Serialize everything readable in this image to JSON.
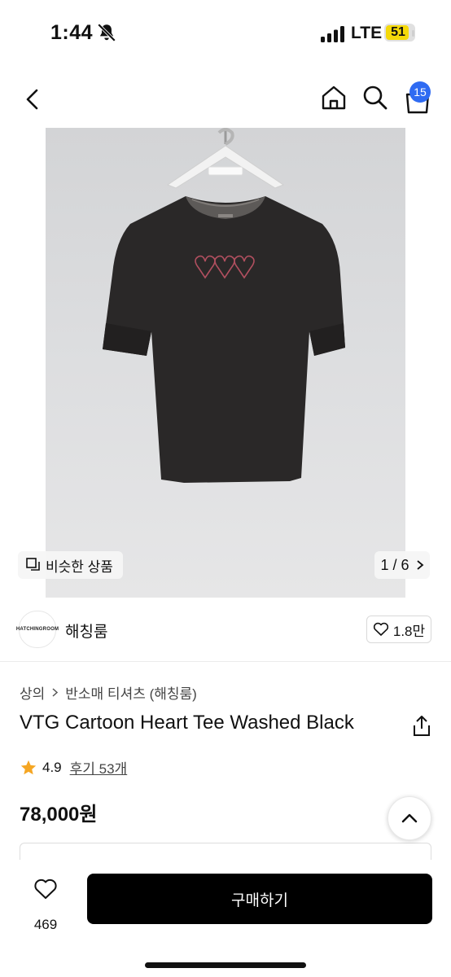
{
  "status_bar": {
    "time": "1:44",
    "network": "LTE",
    "battery": "51",
    "icons": [
      "bell-slash-icon",
      "signal-icon"
    ]
  },
  "header": {
    "icons": [
      "back-arrow-icon",
      "home-icon",
      "search-icon",
      "cart-icon"
    ],
    "cart_count": "15"
  },
  "hero": {
    "similar_label": "비슷한 상품",
    "counter": "1 / 6"
  },
  "shop": {
    "logo_text": "HATCHINGROOM",
    "name": "해칭룸",
    "likes": "1.8만"
  },
  "product": {
    "breadcrumb": [
      "상의",
      "반소매 티셔츠 (해칭룸)"
    ],
    "title": "VTG Cartoon Heart Tee Washed Black",
    "rating": "4.9",
    "reviews": "후기 53개",
    "price": "78,000원"
  },
  "bottom": {
    "wish_count": "469",
    "buy_label": "구매하기"
  },
  "colors": {
    "accent": "#2f6bf2",
    "star": "#f5a623",
    "buy_button": "#000000",
    "battery": "#f5d90a"
  }
}
